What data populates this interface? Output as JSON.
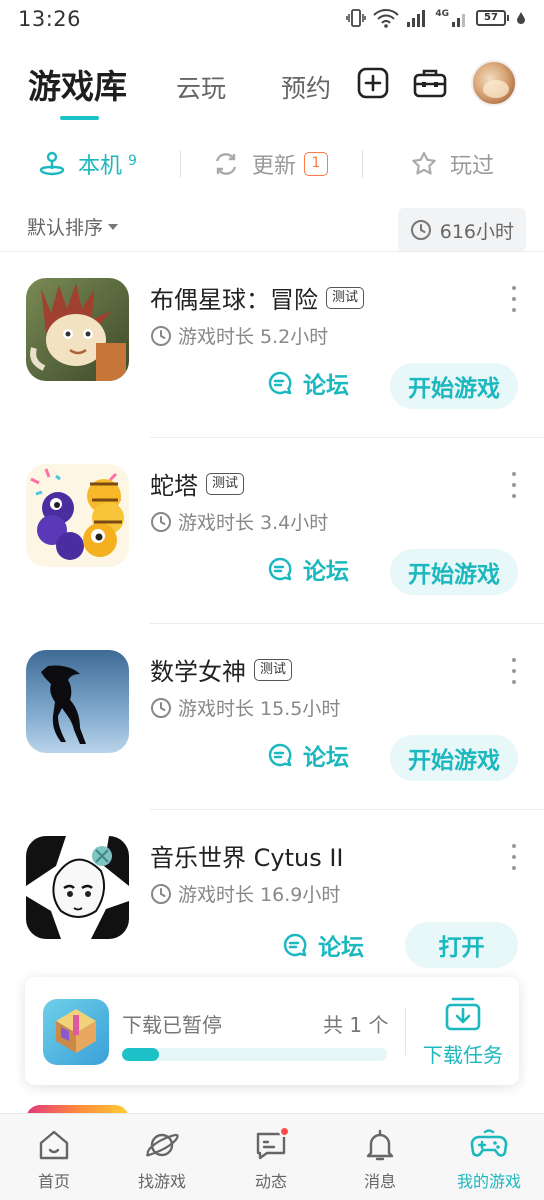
{
  "status_bar": {
    "time": "13:26",
    "network_label": "4G",
    "battery": "57"
  },
  "header": {
    "tabs": [
      {
        "label": "游戏库",
        "active": true
      },
      {
        "label": "云玩",
        "active": false
      },
      {
        "label": "预约",
        "active": false
      }
    ],
    "icons": [
      "add-box-icon",
      "toolbox-icon"
    ]
  },
  "subtabs": {
    "local": {
      "label": "本机",
      "count": "9",
      "icon": "joystick-icon"
    },
    "update": {
      "label": "更新",
      "badge": "1",
      "icon": "refresh-icon"
    },
    "played": {
      "label": "玩过",
      "icon": "star-icon"
    }
  },
  "sort": {
    "label": "默认排序",
    "total_playtime": "616小时"
  },
  "games": [
    {
      "title": "布偶星球：冒险",
      "tag": "测试",
      "playtime": "游戏时长 5.2小时",
      "forum_label": "论坛",
      "action_label": "开始游戏"
    },
    {
      "title": "蛇塔",
      "tag": "测试",
      "playtime": "游戏时长 3.4小时",
      "forum_label": "论坛",
      "action_label": "开始游戏"
    },
    {
      "title": "数学女神",
      "tag": "测试",
      "playtime": "游戏时长 15.5小时",
      "forum_label": "论坛",
      "action_label": "开始游戏"
    },
    {
      "title": "音乐世界 Cytus II",
      "tag": "",
      "playtime": "游戏时长 16.9小时",
      "forum_label": "论坛",
      "action_label": "打开"
    }
  ],
  "download": {
    "status": "下载已暂停",
    "count": "共 1 个",
    "progress": 0.14,
    "task_label": "下载任务"
  },
  "bottom_nav": [
    {
      "label": "首页",
      "icon": "home-icon",
      "active": false
    },
    {
      "label": "找游戏",
      "icon": "planet-icon",
      "active": false
    },
    {
      "label": "动态",
      "icon": "chat-bubble-icon",
      "active": false,
      "notification": true
    },
    {
      "label": "消息",
      "icon": "bell-icon",
      "active": false
    },
    {
      "label": "我的游戏",
      "icon": "gamepad-icon",
      "active": true
    }
  ],
  "colors": {
    "accent": "#1cb8bf",
    "accent_light": "#e8f7f7",
    "badge": "#ff7a45",
    "notification": "#ff4a4a"
  }
}
